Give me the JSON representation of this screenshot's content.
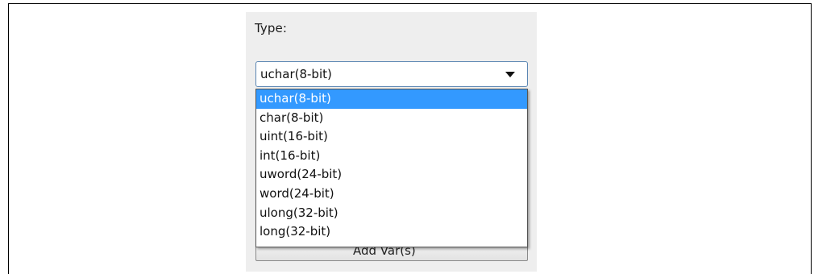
{
  "type_label": "Type:",
  "combo": {
    "selected": "uchar(8-bit)"
  },
  "options": [
    "uchar(8-bit)",
    "char(8-bit)",
    "uint(16-bit)",
    "int(16-bit)",
    "uword(24-bit)",
    "word(24-bit)",
    "ulong(32-bit)",
    "long(32-bit)"
  ],
  "highlighted_option_index": 0,
  "hidden_button_label": "Add Var(s)",
  "colors": {
    "highlight": "#3399ff",
    "panel": "#eeeeee",
    "combo_border": "#5b86b3"
  }
}
